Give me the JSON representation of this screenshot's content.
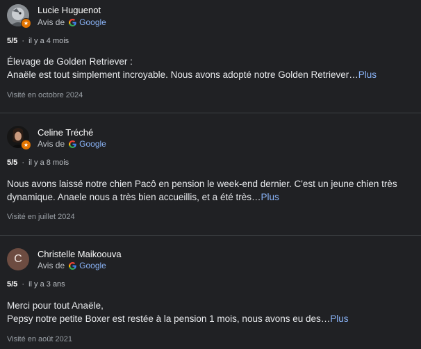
{
  "source_prefix": "Avis de",
  "source_name": "Google",
  "more_label": "Plus",
  "separator": "·",
  "colors": {
    "background": "#202124",
    "link": "#8ab4f8",
    "badge": "#e37400",
    "divider": "#3c4043"
  },
  "reviews": [
    {
      "author": "Lucie Huguenot",
      "rating": "5/5",
      "time": "il y a 4 mois",
      "text_lines": [
        "Élevage de Golden Retriever :",
        "Anaële est tout simplement incroyable. Nous avons adopté notre Golden Retriever…"
      ],
      "visited": "Visité en octobre 2024",
      "avatar": "photo"
    },
    {
      "author": "Celine Tréché",
      "rating": "5/5",
      "time": "il y a 8 mois",
      "text_lines": [
        "Nous avons laissé notre chien Pacô en pension le week-end dernier. C'est un jeune chien très",
        "dynamique. Anaele nous a très bien accueillis, et a été très…"
      ],
      "visited": "Visité en juillet 2024",
      "avatar": "photo"
    },
    {
      "author": "Christelle Maikoouva",
      "rating": "5/5",
      "time": "il y a 3 ans",
      "text_lines": [
        "Merci pour tout Anaële,",
        "Pepsy notre petite Boxer est restée à la pension 1 mois, nous avons eu des…"
      ],
      "visited": "Visité en août 2021",
      "avatar_letter": "C"
    }
  ]
}
